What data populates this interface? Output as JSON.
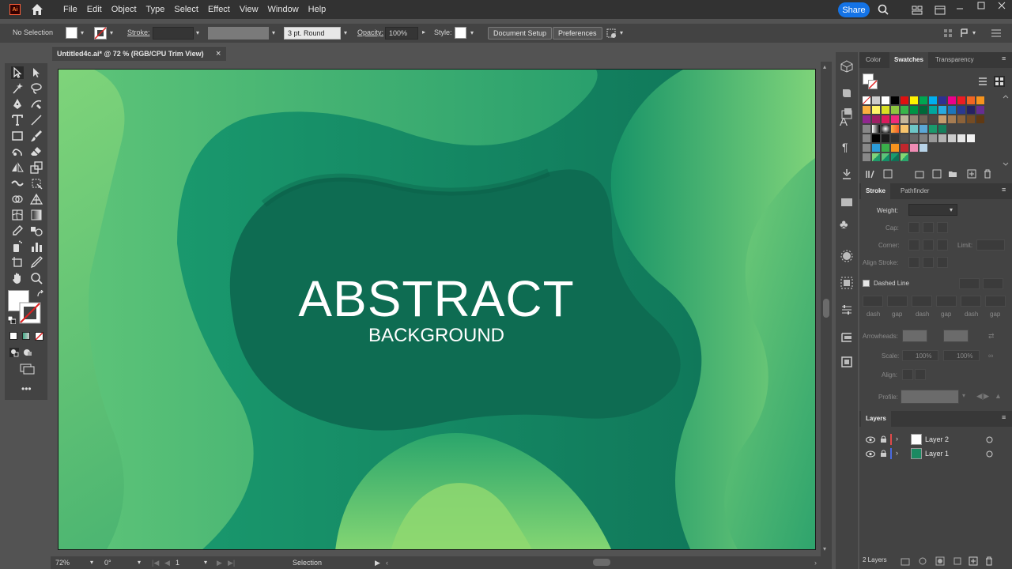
{
  "menubar": {
    "app_logo": "Ai",
    "items": [
      "File",
      "Edit",
      "Object",
      "Type",
      "Select",
      "Effect",
      "View",
      "Window",
      "Help"
    ],
    "share_label": "Share"
  },
  "controlbar": {
    "selection_status": "No Selection",
    "stroke_label": "Stroke:",
    "brush_label": "3 pt. Round",
    "opacity_label": "Opacity:",
    "opacity_value": "100%",
    "style_label": "Style:",
    "document_setup_label": "Document Setup",
    "preferences_label": "Preferences"
  },
  "document_tab": {
    "title": "Untitled4c.ai* @ 72 % (RGB/CPU Trim View)",
    "close_glyph": "×"
  },
  "artwork": {
    "headline": "ABSTRACT",
    "subheadline": "BACKGROUND"
  },
  "swatches_panel": {
    "tabs": [
      "Color",
      "Swatches",
      "Transparency"
    ],
    "active_tab": "Swatches"
  },
  "stroke_panel": {
    "tabs": [
      "Stroke",
      "Pathfinder"
    ],
    "weight_label": "Weight:",
    "cap_label": "Cap:",
    "corner_label": "Corner:",
    "limit_label": "Limit:",
    "align_stroke_label": "Align Stroke:",
    "dashed_line_label": "Dashed Line",
    "dash_gap_labels": [
      "dash",
      "gap",
      "dash",
      "gap",
      "dash",
      "gap"
    ],
    "arrowheads_label": "Arrowheads:",
    "scale_label": "Scale:",
    "scale_values": [
      "100%",
      "100%"
    ],
    "align_label": "Align:",
    "profile_label": "Profile:"
  },
  "layers_panel": {
    "tab": "Layers",
    "layers": [
      {
        "name": "Layer 2",
        "color": "#e04a4a"
      },
      {
        "name": "Layer 1",
        "color": "#4a6ae0"
      }
    ],
    "count_label": "2 Layers"
  },
  "statusbar": {
    "zoom": "72%",
    "rotation": "0°",
    "artboard_number": "1",
    "tool_name": "Selection"
  },
  "colors": {
    "accent": "#1473e6",
    "art_dark": "#0f6e52",
    "art_mid": "#1d9a6c",
    "art_light": "#6fcf72"
  }
}
